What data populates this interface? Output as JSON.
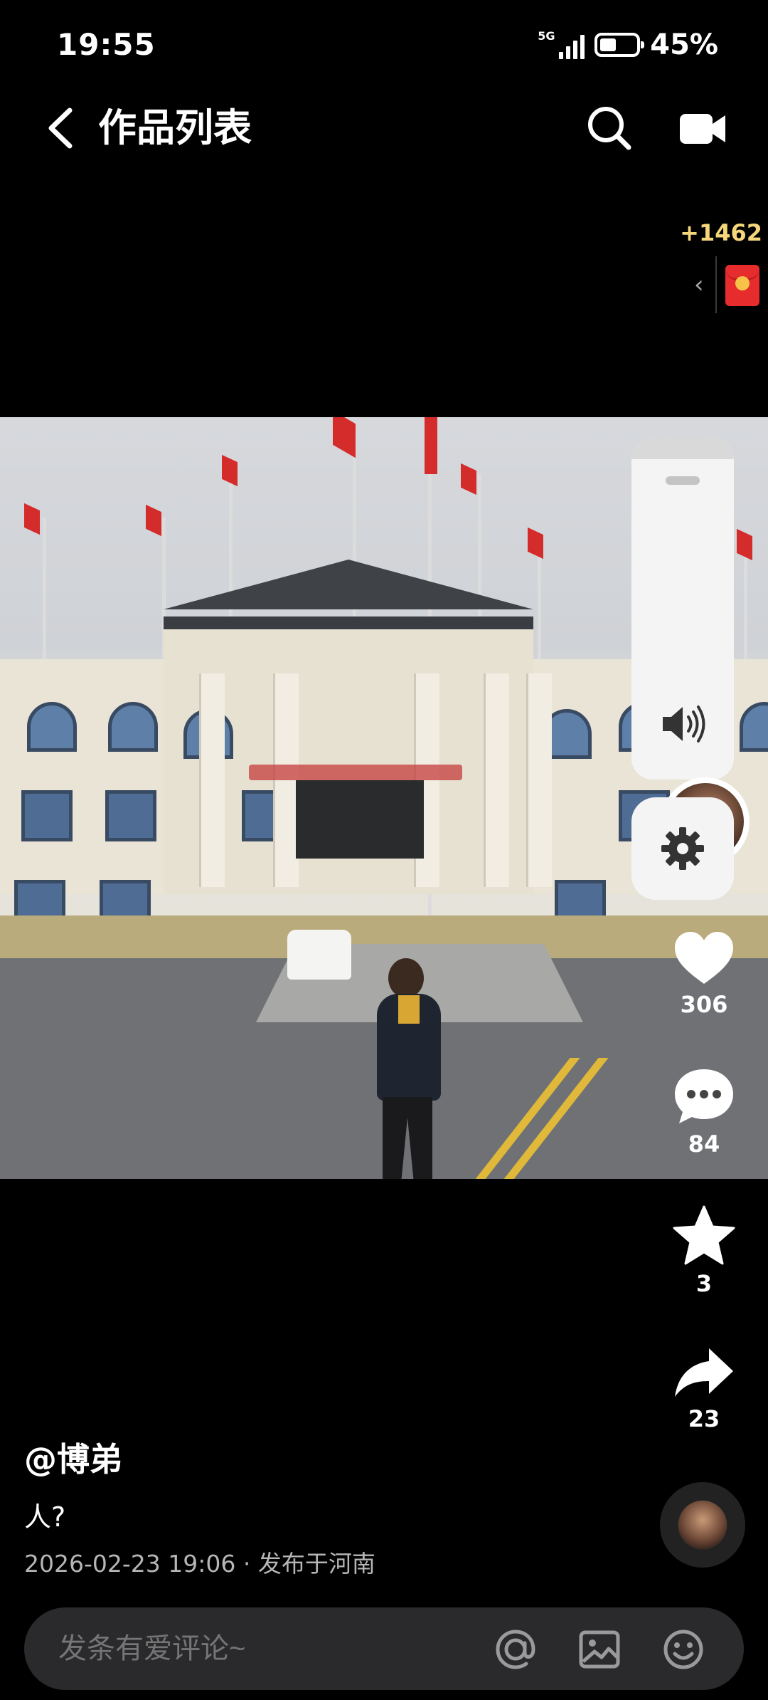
{
  "status_bar": {
    "time": "19:55",
    "network": "5G",
    "battery_percent": "45%",
    "battery_level": 0.45
  },
  "nav": {
    "title": "作品列表",
    "back_icon": "chevron-left-icon",
    "search_icon": "search-icon",
    "camera_icon": "camera-icon"
  },
  "reward": {
    "count": "+1462",
    "chevron": "‹",
    "icon": "red-envelope-icon"
  },
  "video": {
    "description": "building scene"
  },
  "controls": {
    "volume_icon": "volume-icon",
    "settings_icon": "gear-icon"
  },
  "actions": {
    "likes": "306",
    "comments": "84",
    "favorites": "3",
    "shares": "23"
  },
  "post": {
    "author": "@博弟",
    "caption": "人?",
    "meta": "2026-02-23 19:06 · 发布于河南"
  },
  "comment_bar": {
    "placeholder": "发条有爱评论~",
    "mention_icon": "at-icon",
    "image_icon": "image-icon",
    "emoji_icon": "emoji-icon"
  },
  "colors": {
    "background": "#000000",
    "reward_text": "#f5d77a",
    "envelope": "#e62c2c",
    "panel": "#f4f4f4",
    "comment_bar": "#2a2a2c"
  }
}
